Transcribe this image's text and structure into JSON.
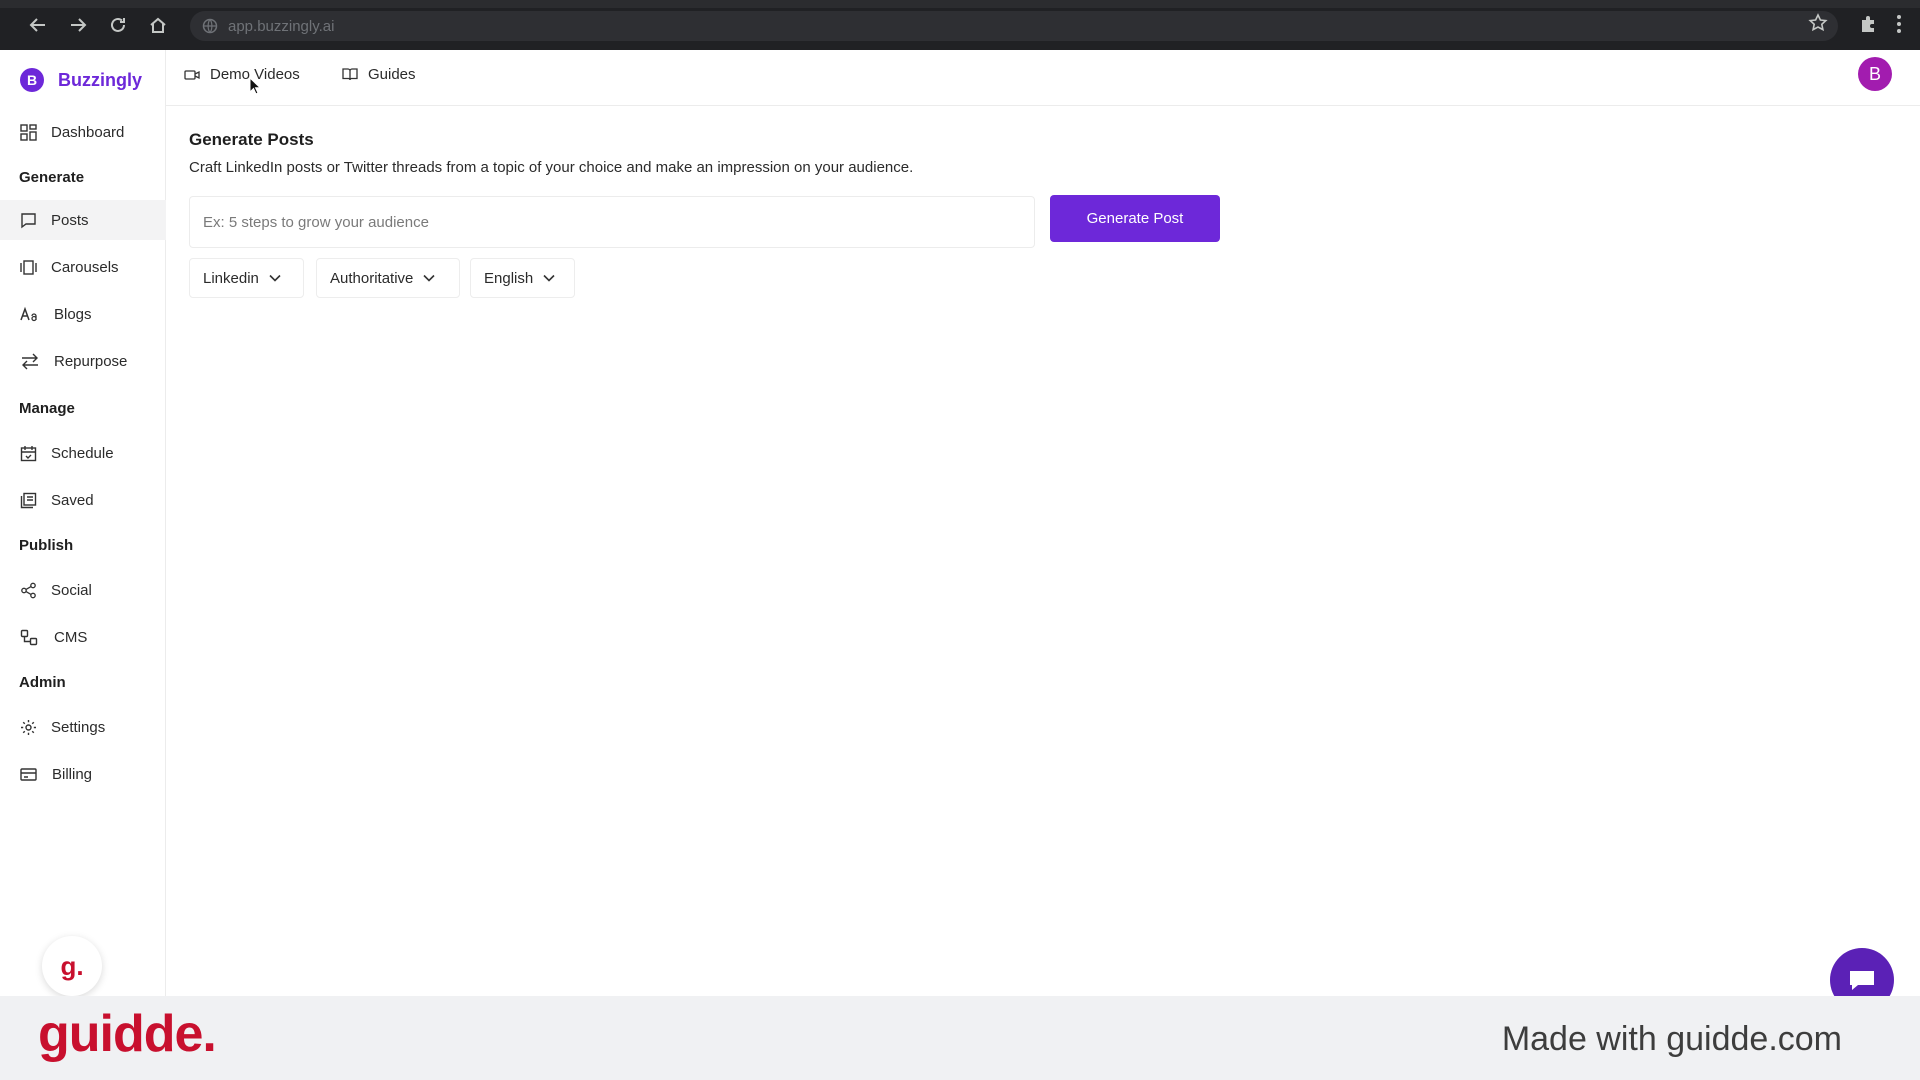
{
  "browser": {
    "url": "app.buzzingly.ai"
  },
  "brand": {
    "logo_letter": "B",
    "name": "Buzzingly",
    "accent_color": "#6d28d9"
  },
  "sidebar": {
    "dashboard": "Dashboard",
    "sections": {
      "generate": "Generate",
      "manage": "Manage",
      "publish": "Publish",
      "admin": "Admin"
    },
    "items": {
      "posts": "Posts",
      "carousels": "Carousels",
      "blogs": "Blogs",
      "repurpose": "Repurpose",
      "schedule": "Schedule",
      "saved": "Saved",
      "social": "Social",
      "cms": "CMS",
      "settings": "Settings",
      "billing": "Billing"
    },
    "active_item": "Posts"
  },
  "topnav": {
    "demo_videos": "Demo Videos",
    "guides": "Guides",
    "avatar_letter": "B"
  },
  "main": {
    "title": "Generate Posts",
    "description": "Craft LinkedIn posts or Twitter threads from a topic of your choice and make an impression on your audience.",
    "input_placeholder": "Ex: 5 steps to grow your audience",
    "input_value": "",
    "generate_button": "Generate Post",
    "selects": {
      "platform": "Linkedin",
      "tone": "Authoritative",
      "language": "English"
    }
  },
  "overlay": {
    "guidde_badge": "g.",
    "footer_logo": "guidde.",
    "footer_text": "Made with guidde.com"
  }
}
